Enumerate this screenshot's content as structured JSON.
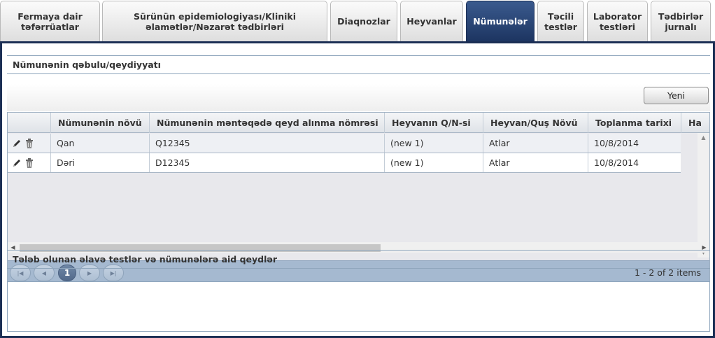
{
  "tabs": [
    {
      "label_line1": "Fermaya dair",
      "label_line2": "təfərrüatlar",
      "active": false
    },
    {
      "label_line1": "Sürünün epidemiologiyası/Kliniki",
      "label_line2": "əlamətlər/Nəzarət tədbirləri",
      "active": false
    },
    {
      "label_line1": "Diaqnozlar",
      "label_line2": "",
      "active": false
    },
    {
      "label_line1": "Heyvanlar",
      "label_line2": "",
      "active": false
    },
    {
      "label_line1": "Nümunələr",
      "label_line2": "",
      "active": true
    },
    {
      "label_line1": "Təcili",
      "label_line2": "testlər",
      "active": false
    },
    {
      "label_line1": "Laborator",
      "label_line2": "testləri",
      "active": false
    },
    {
      "label_line1": "Tədbirlər",
      "label_line2": "jurnalı",
      "active": false
    }
  ],
  "samples_section": {
    "title": "Nümunənin qəbulu/qeydiyyatı"
  },
  "toolbar": {
    "new_label": "Yeni"
  },
  "grid": {
    "columns": [
      "",
      "Nümunənin növü",
      "Nümunənin məntəqədə qeyd alınma nömrəsi",
      "Heyvanın Q/N-si",
      "Heyvan/Quş Növü",
      "Toplanma tarixi",
      "Ha"
    ],
    "rows": [
      {
        "type": "Qan",
        "reg_no": "Q12345",
        "animal_id": "(new 1)",
        "species": "Atlar",
        "date": "10/8/2014"
      },
      {
        "type": "Dəri",
        "reg_no": "D12345",
        "animal_id": "(new 1)",
        "species": "Atlar",
        "date": "10/8/2014"
      }
    ]
  },
  "pager": {
    "current_page": "1",
    "info": "1 - 2 of 2 items"
  },
  "notes_section": {
    "title": "Tələb olunan əlavə testlər və nümunələrə aid qeydlər",
    "value": ""
  },
  "colors": {
    "accent": "#1c2f55",
    "pager_bg": "#a5b9d0"
  }
}
